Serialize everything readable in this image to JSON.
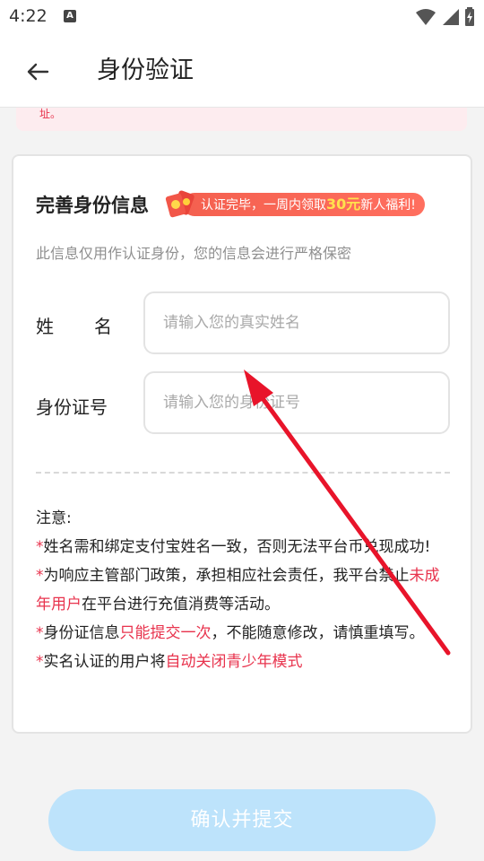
{
  "status_bar": {
    "time": "4:22",
    "badge": "A",
    "icons": [
      "wifi-icon",
      "signal-icon",
      "battery-icon"
    ]
  },
  "header": {
    "title": "身份验证",
    "back_icon": "arrow-left-icon"
  },
  "notice": {
    "text": "址。"
  },
  "card": {
    "title": "完善身份信息",
    "promo": {
      "prefix": "认证完毕，一周内领取",
      "amount": "30元",
      "suffix": "新人福利!"
    },
    "subtitle": "此信息仅用作认证身份，您的信息会进行严格保密",
    "fields": {
      "name": {
        "label_part1": "姓",
        "label_part2": "名",
        "placeholder": "请输入您的真实姓名",
        "value": ""
      },
      "id_number": {
        "label": "身份证号",
        "placeholder": "请输入您的身份证号",
        "value": ""
      }
    },
    "notes": {
      "heading": "注意:",
      "star": "*",
      "n1": "姓名需和绑定支付宝姓名一致，否则无法平台币兑现成功!",
      "n2_a": "为响应主管部门政策，承担相应社会责任，我平台禁止",
      "n2_hl": "未成年用户",
      "n2_b": "在平台进行充值消费等活动。",
      "n3_a": "身份证信息",
      "n3_hl": "只能提交一次",
      "n3_b": "，不能随意修改，请慎重填写。",
      "n4_a": "实名认证的用户将",
      "n4_hl": "自动关闭青少年模式"
    }
  },
  "submit": {
    "label": "确认并提交"
  },
  "colors": {
    "accent_red": "#e8334d",
    "submit_bg": "#bde3fb",
    "annotation_arrow": "#e8142a"
  }
}
